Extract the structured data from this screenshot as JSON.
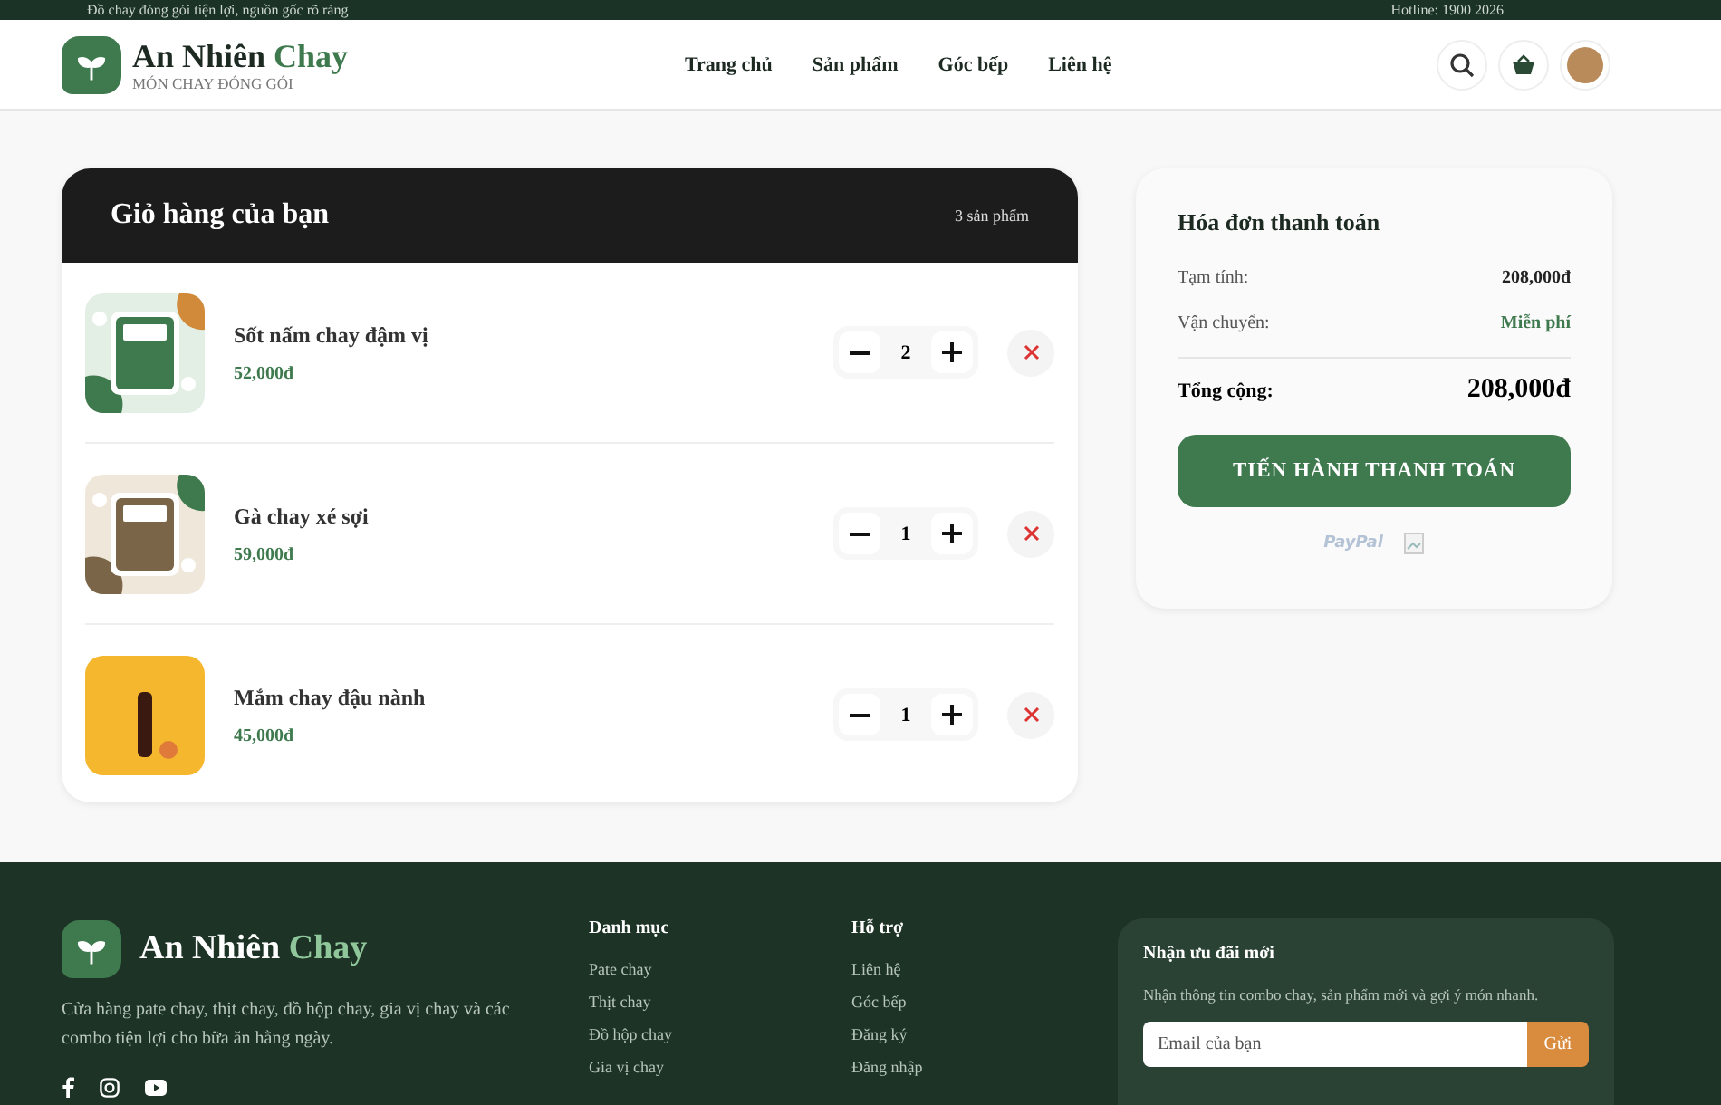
{
  "top_bar": {
    "tagline": "Đồ chay đóng gói tiện lợi, nguồn gốc rõ ràng",
    "hotline": "Hotline: 1900 2026"
  },
  "header": {
    "brand": {
      "name": "An Nhiên",
      "accent": "Chay",
      "tagline": "MÓN CHAY ĐÓNG GÓI"
    },
    "nav": [
      {
        "label": "Trang chủ"
      },
      {
        "label": "Sản phẩm"
      },
      {
        "label": "Góc bếp"
      },
      {
        "label": "Liên hệ"
      }
    ]
  },
  "cart": {
    "title": "Giỏ hàng của bạn",
    "count": "3 sản phẩm",
    "items": [
      {
        "name": "Sốt nấm chay đậm vị",
        "price": "52,000đ",
        "quantity": "2"
      },
      {
        "name": "Gà chay xé sợi",
        "price": "59,000đ",
        "quantity": "1"
      },
      {
        "name": "Mắm chay đậu nành",
        "price": "45,000đ",
        "quantity": "1"
      }
    ]
  },
  "summary": {
    "title": "Hóa đơn thanh toán",
    "rows": [
      {
        "label": "Tạm tính:",
        "value": "208,000đ",
        "kind": "plain"
      },
      {
        "label": "Vận chuyển:",
        "value": "Miễn phí",
        "kind": "free"
      }
    ],
    "total_label": "Tổng cộng:",
    "total": "208,000đ",
    "checkout": "TIẾN HÀNH THANH TOÁN",
    "payment": "PayPal"
  },
  "footer": {
    "brand": {
      "name": "An Nhiên",
      "accent": "Chay"
    },
    "about": "Cửa hàng pate chay, thịt chay, đồ hộp chay, gia vị chay và các combo tiện lợi cho bữa ăn hằng ngày.",
    "columns": [
      {
        "title": "Danh mục",
        "links": [
          "Pate chay",
          "Thịt chay",
          "Đồ hộp chay",
          "Gia vị chay"
        ]
      },
      {
        "title": "Hỗ trợ",
        "links": [
          "Liên hệ",
          "Góc bếp",
          "Đăng ký",
          "Đăng nhập"
        ]
      }
    ],
    "newsletter": {
      "title": "Nhận ưu đãi mới",
      "text": "Nhận thông tin combo chay, sản phẩm mới và gợi ý món nhanh.",
      "placeholder": "Email của bạn",
      "button": "Gửi"
    }
  }
}
